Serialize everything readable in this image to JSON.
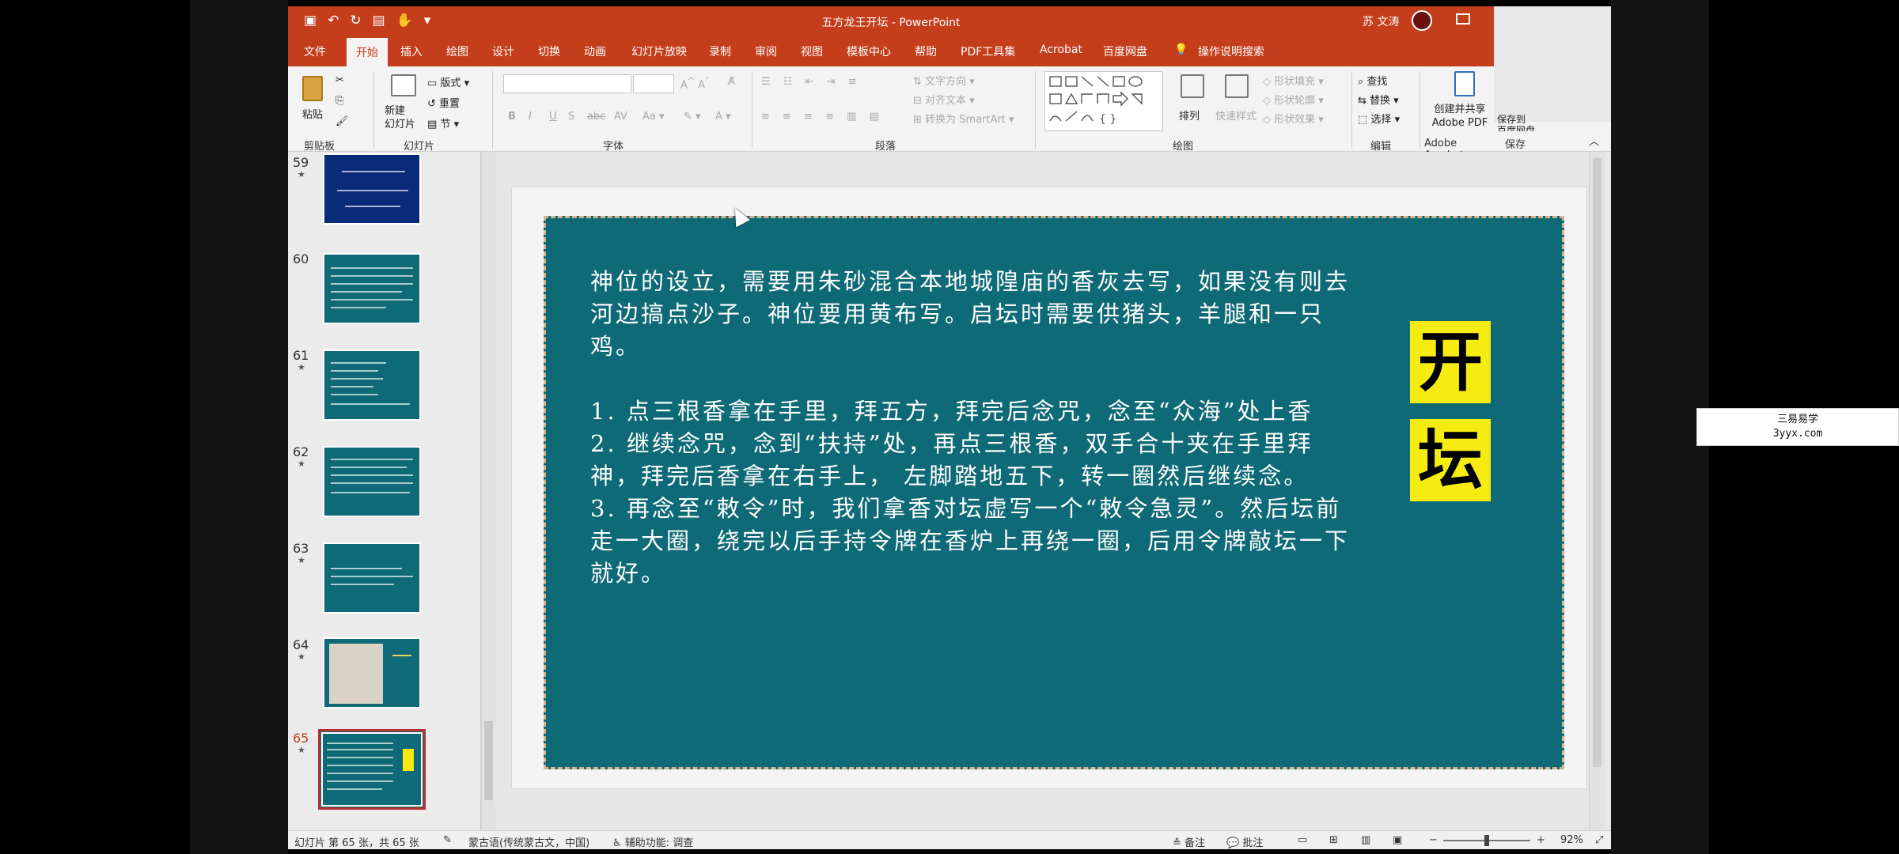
{
  "window": {
    "title": "五方龙王开坛 - PowerPoint",
    "user": "苏 文涛"
  },
  "tabs": [
    "文件",
    "开始",
    "插入",
    "绘图",
    "设计",
    "切换",
    "动画",
    "幻灯片放映",
    "录制",
    "审阅",
    "视图",
    "模板中心",
    "帮助",
    "PDF工具集",
    "Acrobat",
    "百度网盘"
  ],
  "tell_me": "操作说明搜索",
  "ribbon": {
    "groups": {
      "clipboard": "剪贴板",
      "slides": "幻灯片",
      "font": "字体",
      "paragraph": "段落",
      "drawing": "绘图",
      "editing": "编辑",
      "adobe": "Adobe Acrobat",
      "save": "保存"
    },
    "paste": "粘贴",
    "new_slide": "新建\n幻灯片",
    "layout": "版式",
    "reset": "重置",
    "section": "节",
    "text_direction": "文字方向",
    "align_text": "对齐文本",
    "convert_smartart": "转换为 SmartArt",
    "arrange": "排列",
    "quick_styles": "快速样式",
    "shape_fill": "形状填充",
    "shape_outline": "形状轮廓",
    "shape_effects": "形状效果",
    "find": "查找",
    "replace": "替换",
    "select": "选择",
    "create_share": "创建并共享\nAdobe PDF",
    "save_baidu": "保存到\n百度网盘"
  },
  "thumbnails": [
    {
      "num": "59"
    },
    {
      "num": "60"
    },
    {
      "num": "61"
    },
    {
      "num": "62"
    },
    {
      "num": "63"
    },
    {
      "num": "64"
    },
    {
      "num": "65"
    }
  ],
  "slide": {
    "para1": "神位的设立，需要用朱砂混合本地城隍庙的香灰去写，如果没有则去河边搞点沙子。神位要用黄布写。启坛时需要供猪头，羊腿和一只鸡。",
    "step1": "1. 点三根香拿在手里，拜五方，拜完后念咒，念至“众海”处上香",
    "step2": "2. 继续念咒，念到“扶持”处，再点三根香，双手合十夹在手里拜神，拜完后香拿在右手上， 左脚踏地五下，转一圈然后继续念。",
    "step3": "3. 再念至“敕令”时，我们拿香对坛虚写一个“敕令急灵”。然后坛前走一大圈，绕完以后手持令牌在香炉上再绕一圈，后用令牌敲坛一下就好。",
    "title_char1": "开",
    "title_char2": "坛"
  },
  "status": {
    "slide_count": "幻灯片 第 65 张，共 65 张",
    "language": "蒙古语(传统蒙古文，中国)",
    "accessibility": "辅助功能: 调查",
    "notes": "备注",
    "comments": "批注",
    "zoom": "92%"
  },
  "watermark": {
    "line1": "三易易学",
    "line2": "3yyx.com"
  },
  "colors": {
    "accent": "#c43e1c",
    "slide_bg": "#0e6a76",
    "title_box": "#f7ec12"
  }
}
